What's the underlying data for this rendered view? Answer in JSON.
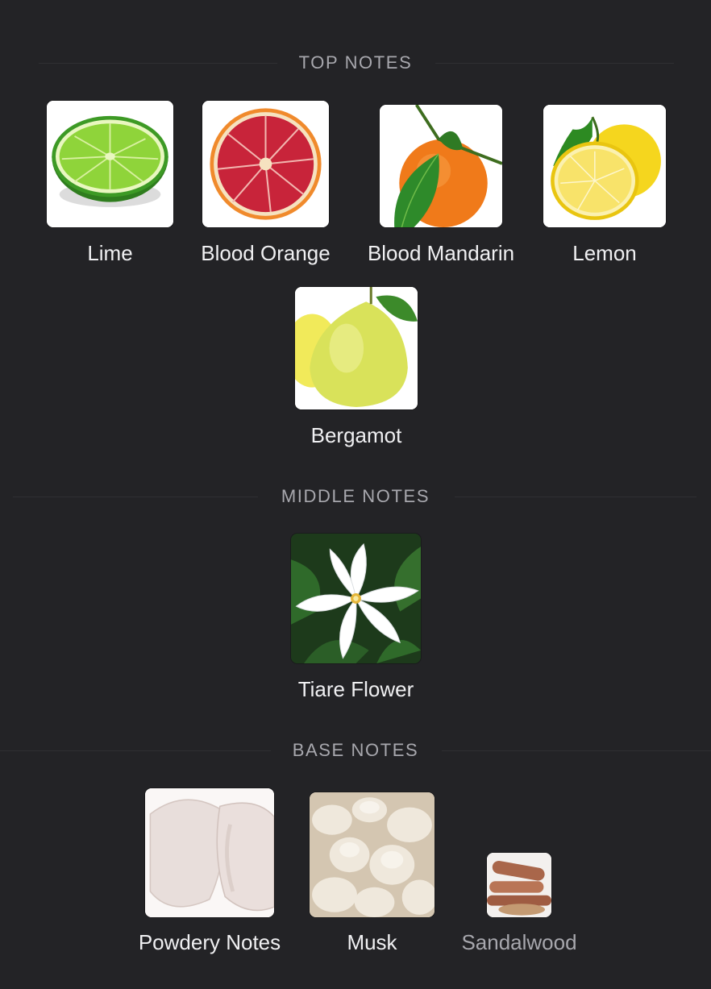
{
  "sections": {
    "top": {
      "title": "TOP NOTES",
      "notes": [
        {
          "label": "Lime",
          "icon": "lime-icon"
        },
        {
          "label": "Blood Orange",
          "icon": "blood-orange-icon"
        },
        {
          "label": "Blood Mandarin",
          "icon": "blood-mandarin-icon"
        },
        {
          "label": "Lemon",
          "icon": "lemon-icon"
        },
        {
          "label": "Bergamot",
          "icon": "bergamot-icon"
        }
      ]
    },
    "middle": {
      "title": "MIDDLE NOTES",
      "notes": [
        {
          "label": "Tiare Flower",
          "icon": "tiare-flower-icon"
        }
      ]
    },
    "base": {
      "title": "BASE NOTES",
      "notes": [
        {
          "label": "Powdery Notes",
          "icon": "powder-icon"
        },
        {
          "label": "Musk",
          "icon": "musk-icon"
        },
        {
          "label": "Sandalwood",
          "icon": "sandalwood-icon"
        }
      ]
    }
  },
  "colors": {
    "background": "#232326",
    "header_text": "#a8a8ae",
    "label_text": "#f0f0f2",
    "dim_label_text": "#a7a7ad"
  }
}
